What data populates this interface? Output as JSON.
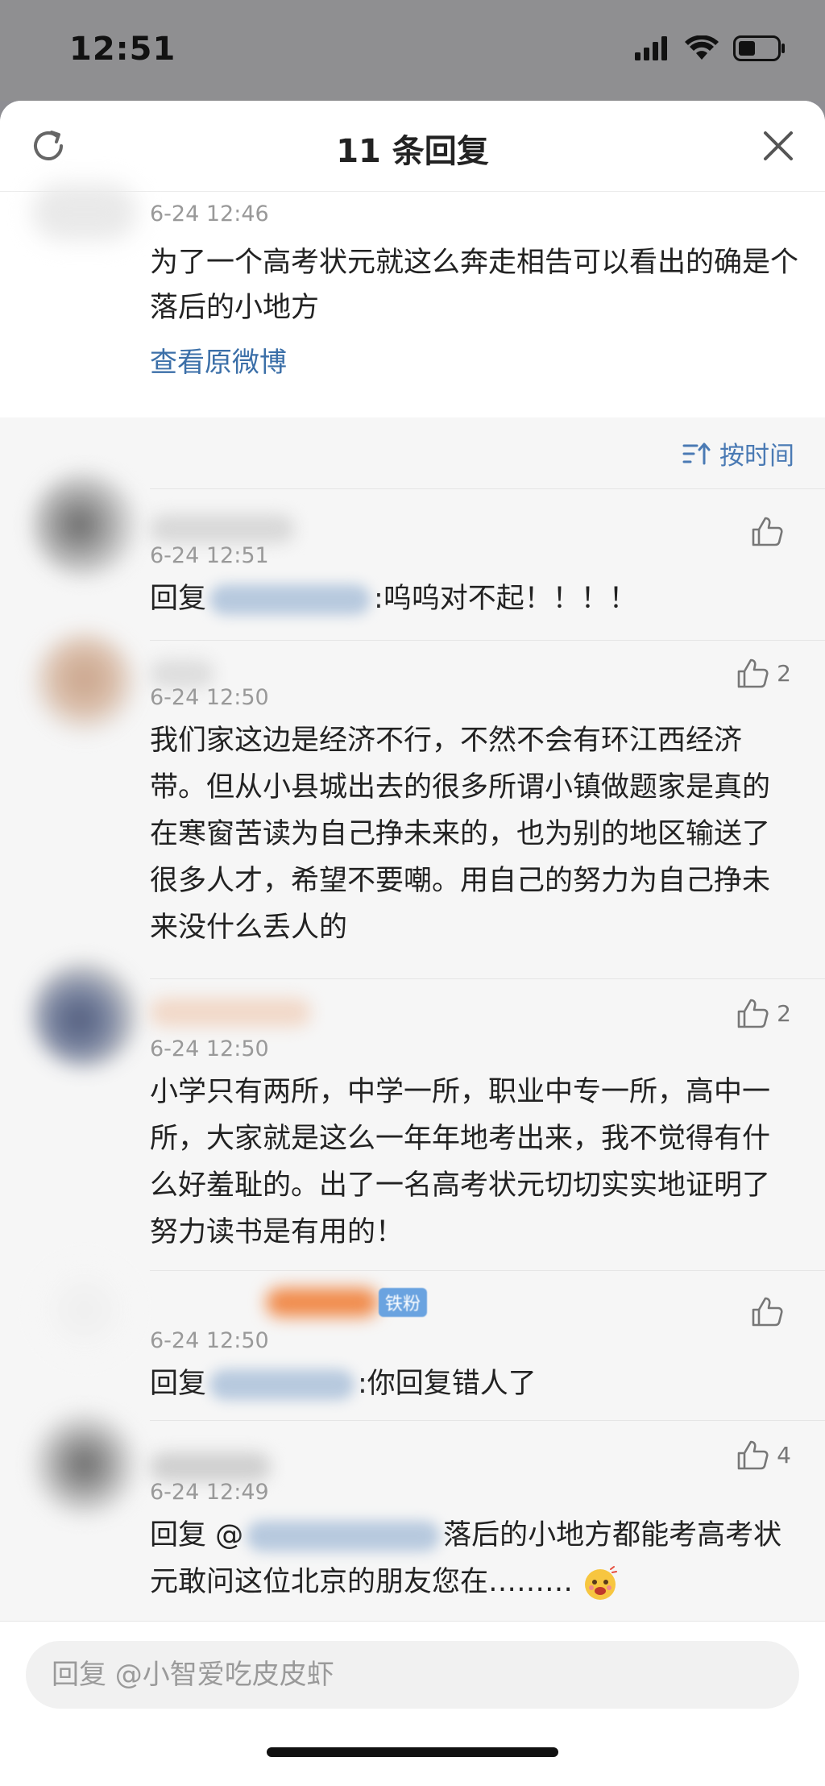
{
  "status_bar": {
    "time": "12:51"
  },
  "header": {
    "title": "11 条回复"
  },
  "original_comment": {
    "time": "6-24 12:46",
    "text": "为了一个高考状元就这么奔走相告可以看出的确是个落后的小地方",
    "link_label": "查看原微博"
  },
  "sort": {
    "label": "按时间"
  },
  "replies": [
    {
      "time": "6-24 12:51",
      "text_prefix": "回复",
      "text_suffix": ":呜呜对不起！！！！",
      "likes": ""
    },
    {
      "time": "6-24 12:50",
      "text": "我们家这边是经济不行，不然不会有环江西经济带。但从小县城出去的很多所谓小镇做题家是真的在寒窗苦读为自己挣未来的，也为别的地区输送了很多人才，希望不要嘲。用自己的努力为自己挣未来没什么丢人的",
      "likes": "2"
    },
    {
      "time": "6-24 12:50",
      "text": "小学只有两所，中学一所，职业中专一所，高中一所，大家就是这么一年年地考出来，我不觉得有什么好羞耻的。出了一名高考状元切切实实地证明了努力读书是有用的！",
      "likes": "2"
    },
    {
      "time": "6-24 12:50",
      "badge": "铁粉",
      "text_prefix": "回复",
      "text_suffix": ":你回复错人了",
      "likes": ""
    },
    {
      "time": "6-24 12:49",
      "text_prefix": "回复 @",
      "text_suffix": "落后的小地方都能考高考状元敢问这位北京的朋友您在………",
      "likes": "4"
    }
  ],
  "composer": {
    "placeholder": "回复 @小智爱吃皮皮虾"
  },
  "colors": {
    "link": "#3b6fa8",
    "sort": "#4a7ab4",
    "badge": "#6aa3e0"
  }
}
